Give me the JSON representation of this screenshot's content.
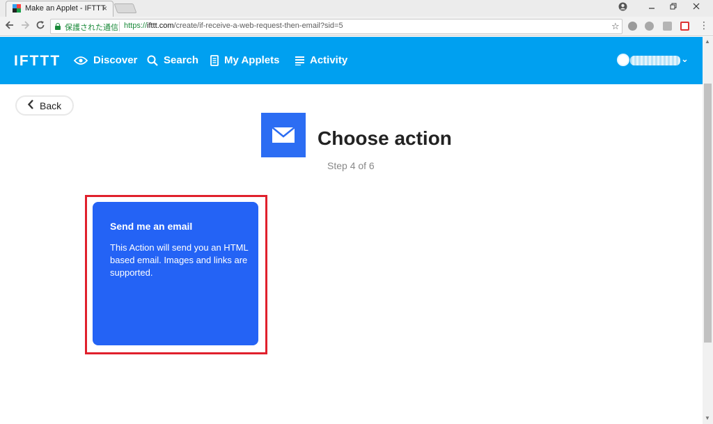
{
  "browser": {
    "tab_title": "Make an Applet - IFTTT",
    "tab_close": "×",
    "secure_label": "保護された通信",
    "url_scheme": "https://",
    "url_host": "ifttt.com",
    "url_path": "/create/if-receive-a-web-request-then-email?sid=5"
  },
  "header": {
    "logo": "IFTTT",
    "nav": [
      {
        "label": "Discover",
        "icon": "eye-icon"
      },
      {
        "label": "Search",
        "icon": "search-icon"
      },
      {
        "label": "My Applets",
        "icon": "document-icon"
      },
      {
        "label": "Activity",
        "icon": "list-icon"
      }
    ]
  },
  "content": {
    "back_label": "Back",
    "title": "Choose action",
    "step": "Step 4 of 6",
    "action_card": {
      "title": "Send me an email",
      "description": "This Action will send you an HTML based email. Images and links are supported."
    }
  },
  "colors": {
    "header_bg": "#00a0f0",
    "card_bg": "#2463f5",
    "service_icon_bg": "#2c6df3",
    "highlight": "#e0202c"
  }
}
